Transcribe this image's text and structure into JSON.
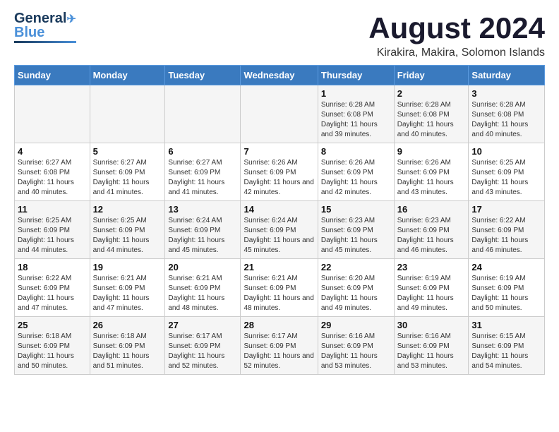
{
  "header": {
    "logo_general": "General",
    "logo_blue": "Blue",
    "main_title": "August 2024",
    "subtitle": "Kirakira, Makira, Solomon Islands"
  },
  "calendar": {
    "weekdays": [
      "Sunday",
      "Monday",
      "Tuesday",
      "Wednesday",
      "Thursday",
      "Friday",
      "Saturday"
    ],
    "weeks": [
      [
        {
          "day": "",
          "sunrise": "",
          "sunset": "",
          "daylight": ""
        },
        {
          "day": "",
          "sunrise": "",
          "sunset": "",
          "daylight": ""
        },
        {
          "day": "",
          "sunrise": "",
          "sunset": "",
          "daylight": ""
        },
        {
          "day": "",
          "sunrise": "",
          "sunset": "",
          "daylight": ""
        },
        {
          "day": "1",
          "sunrise": "Sunrise: 6:28 AM",
          "sunset": "Sunset: 6:08 PM",
          "daylight": "Daylight: 11 hours and 39 minutes."
        },
        {
          "day": "2",
          "sunrise": "Sunrise: 6:28 AM",
          "sunset": "Sunset: 6:08 PM",
          "daylight": "Daylight: 11 hours and 40 minutes."
        },
        {
          "day": "3",
          "sunrise": "Sunrise: 6:28 AM",
          "sunset": "Sunset: 6:08 PM",
          "daylight": "Daylight: 11 hours and 40 minutes."
        }
      ],
      [
        {
          "day": "4",
          "sunrise": "Sunrise: 6:27 AM",
          "sunset": "Sunset: 6:08 PM",
          "daylight": "Daylight: 11 hours and 40 minutes."
        },
        {
          "day": "5",
          "sunrise": "Sunrise: 6:27 AM",
          "sunset": "Sunset: 6:09 PM",
          "daylight": "Daylight: 11 hours and 41 minutes."
        },
        {
          "day": "6",
          "sunrise": "Sunrise: 6:27 AM",
          "sunset": "Sunset: 6:09 PM",
          "daylight": "Daylight: 11 hours and 41 minutes."
        },
        {
          "day": "7",
          "sunrise": "Sunrise: 6:26 AM",
          "sunset": "Sunset: 6:09 PM",
          "daylight": "Daylight: 11 hours and 42 minutes."
        },
        {
          "day": "8",
          "sunrise": "Sunrise: 6:26 AM",
          "sunset": "Sunset: 6:09 PM",
          "daylight": "Daylight: 11 hours and 42 minutes."
        },
        {
          "day": "9",
          "sunrise": "Sunrise: 6:26 AM",
          "sunset": "Sunset: 6:09 PM",
          "daylight": "Daylight: 11 hours and 43 minutes."
        },
        {
          "day": "10",
          "sunrise": "Sunrise: 6:25 AM",
          "sunset": "Sunset: 6:09 PM",
          "daylight": "Daylight: 11 hours and 43 minutes."
        }
      ],
      [
        {
          "day": "11",
          "sunrise": "Sunrise: 6:25 AM",
          "sunset": "Sunset: 6:09 PM",
          "daylight": "Daylight: 11 hours and 44 minutes."
        },
        {
          "day": "12",
          "sunrise": "Sunrise: 6:25 AM",
          "sunset": "Sunset: 6:09 PM",
          "daylight": "Daylight: 11 hours and 44 minutes."
        },
        {
          "day": "13",
          "sunrise": "Sunrise: 6:24 AM",
          "sunset": "Sunset: 6:09 PM",
          "daylight": "Daylight: 11 hours and 45 minutes."
        },
        {
          "day": "14",
          "sunrise": "Sunrise: 6:24 AM",
          "sunset": "Sunset: 6:09 PM",
          "daylight": "Daylight: 11 hours and 45 minutes."
        },
        {
          "day": "15",
          "sunrise": "Sunrise: 6:23 AM",
          "sunset": "Sunset: 6:09 PM",
          "daylight": "Daylight: 11 hours and 45 minutes."
        },
        {
          "day": "16",
          "sunrise": "Sunrise: 6:23 AM",
          "sunset": "Sunset: 6:09 PM",
          "daylight": "Daylight: 11 hours and 46 minutes."
        },
        {
          "day": "17",
          "sunrise": "Sunrise: 6:22 AM",
          "sunset": "Sunset: 6:09 PM",
          "daylight": "Daylight: 11 hours and 46 minutes."
        }
      ],
      [
        {
          "day": "18",
          "sunrise": "Sunrise: 6:22 AM",
          "sunset": "Sunset: 6:09 PM",
          "daylight": "Daylight: 11 hours and 47 minutes."
        },
        {
          "day": "19",
          "sunrise": "Sunrise: 6:21 AM",
          "sunset": "Sunset: 6:09 PM",
          "daylight": "Daylight: 11 hours and 47 minutes."
        },
        {
          "day": "20",
          "sunrise": "Sunrise: 6:21 AM",
          "sunset": "Sunset: 6:09 PM",
          "daylight": "Daylight: 11 hours and 48 minutes."
        },
        {
          "day": "21",
          "sunrise": "Sunrise: 6:21 AM",
          "sunset": "Sunset: 6:09 PM",
          "daylight": "Daylight: 11 hours and 48 minutes."
        },
        {
          "day": "22",
          "sunrise": "Sunrise: 6:20 AM",
          "sunset": "Sunset: 6:09 PM",
          "daylight": "Daylight: 11 hours and 49 minutes."
        },
        {
          "day": "23",
          "sunrise": "Sunrise: 6:19 AM",
          "sunset": "Sunset: 6:09 PM",
          "daylight": "Daylight: 11 hours and 49 minutes."
        },
        {
          "day": "24",
          "sunrise": "Sunrise: 6:19 AM",
          "sunset": "Sunset: 6:09 PM",
          "daylight": "Daylight: 11 hours and 50 minutes."
        }
      ],
      [
        {
          "day": "25",
          "sunrise": "Sunrise: 6:18 AM",
          "sunset": "Sunset: 6:09 PM",
          "daylight": "Daylight: 11 hours and 50 minutes."
        },
        {
          "day": "26",
          "sunrise": "Sunrise: 6:18 AM",
          "sunset": "Sunset: 6:09 PM",
          "daylight": "Daylight: 11 hours and 51 minutes."
        },
        {
          "day": "27",
          "sunrise": "Sunrise: 6:17 AM",
          "sunset": "Sunset: 6:09 PM",
          "daylight": "Daylight: 11 hours and 52 minutes."
        },
        {
          "day": "28",
          "sunrise": "Sunrise: 6:17 AM",
          "sunset": "Sunset: 6:09 PM",
          "daylight": "Daylight: 11 hours and 52 minutes."
        },
        {
          "day": "29",
          "sunrise": "Sunrise: 6:16 AM",
          "sunset": "Sunset: 6:09 PM",
          "daylight": "Daylight: 11 hours and 53 minutes."
        },
        {
          "day": "30",
          "sunrise": "Sunrise: 6:16 AM",
          "sunset": "Sunset: 6:09 PM",
          "daylight": "Daylight: 11 hours and 53 minutes."
        },
        {
          "day": "31",
          "sunrise": "Sunrise: 6:15 AM",
          "sunset": "Sunset: 6:09 PM",
          "daylight": "Daylight: 11 hours and 54 minutes."
        }
      ]
    ]
  }
}
